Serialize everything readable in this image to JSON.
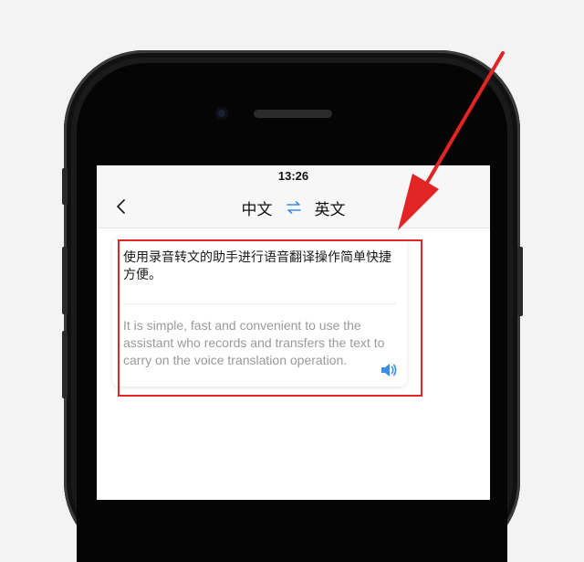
{
  "status_bar": {
    "time": "13:26"
  },
  "nav": {
    "back_icon": "chevron-left-icon",
    "source_lang": "中文",
    "swap_icon": "swap-arrows-icon",
    "target_lang": "英文"
  },
  "translation_card": {
    "source_text": "使用录音转文的助手进行语音翻译操作简单快捷方便。",
    "target_text": "It is simple, fast and convenient to use the assistant who records and transfers the text to carry on the voice translation operation.",
    "speaker_icon": "speaker-volume-icon"
  },
  "annotation": {
    "color": "#e32424"
  },
  "colors": {
    "accent": "#3a8ee6",
    "card_shadow": "rgba(0,0,0,0.12)"
  }
}
